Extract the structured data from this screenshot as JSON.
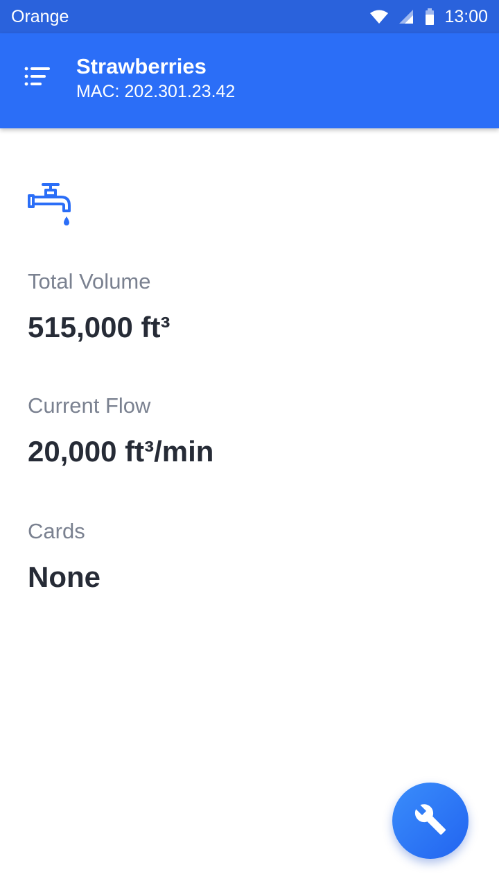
{
  "status_bar": {
    "carrier": "Orange",
    "time": "13:00",
    "icons": [
      "wifi-icon",
      "cellular-signal-icon",
      "battery-icon"
    ]
  },
  "app_bar": {
    "title": "Strawberries",
    "subtitle": "MAC: 202.301.23.42",
    "menu_icon": "menu-list-icon",
    "background_color": "#2b6ef7"
  },
  "device": {
    "icon": "faucet-icon",
    "fields": [
      {
        "label": "Total Volume",
        "value": "515,000 ft³"
      },
      {
        "label": "Current Flow",
        "value": "20,000 ft³/min"
      },
      {
        "label": "Cards",
        "value": "None"
      }
    ]
  },
  "fab": {
    "icon": "wrench-icon",
    "color": "#2b6ef7"
  }
}
